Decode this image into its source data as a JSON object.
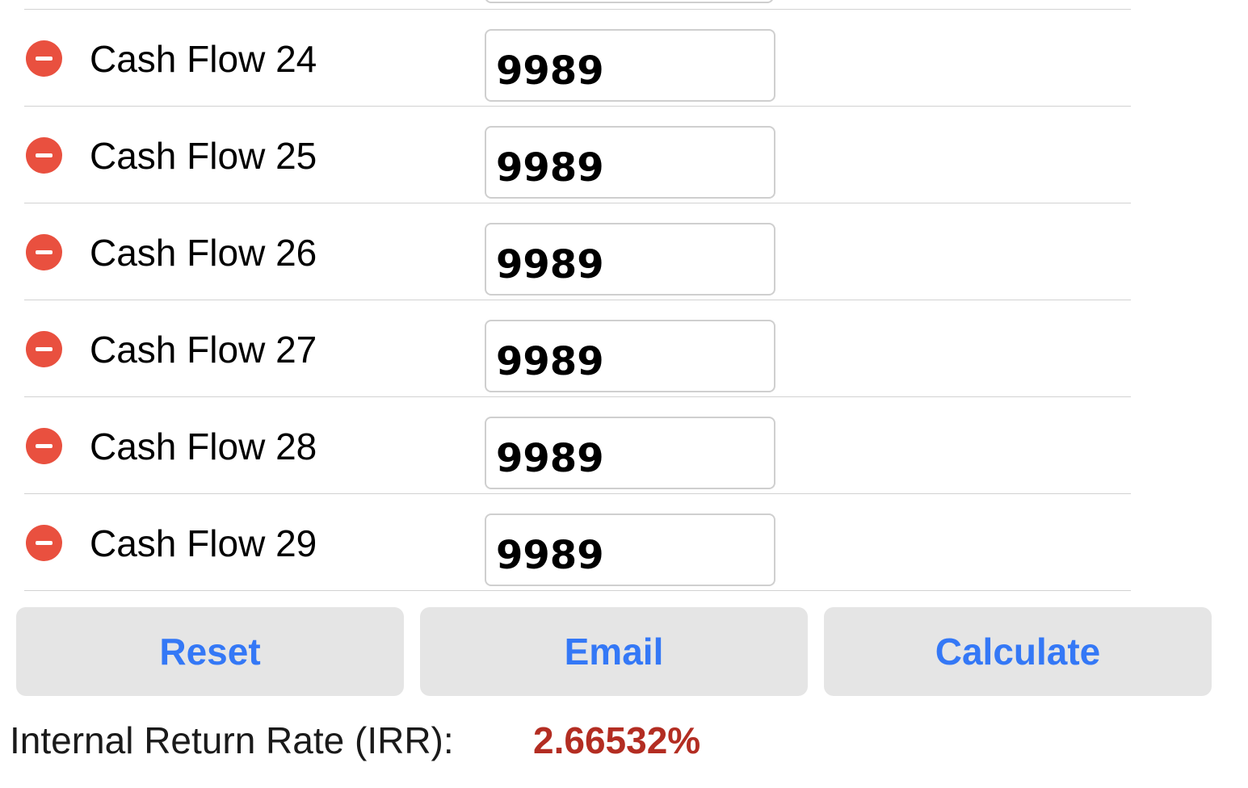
{
  "cash_flows": [
    {
      "label": "Cash Flow 24",
      "value": "9989"
    },
    {
      "label": "Cash Flow 25",
      "value": "9989"
    },
    {
      "label": "Cash Flow 26",
      "value": "9989"
    },
    {
      "label": "Cash Flow 27",
      "value": "9989"
    },
    {
      "label": "Cash Flow 28",
      "value": "9989"
    },
    {
      "label": "Cash Flow 29",
      "value": "9989"
    }
  ],
  "buttons": {
    "reset_label": "Reset",
    "email_label": "Email",
    "calculate_label": "Calculate"
  },
  "result": {
    "label": "Internal Return Rate (IRR):",
    "value": "2.66532%"
  },
  "icons": {
    "remove": "minus-circle-icon"
  },
  "colors": {
    "remove_red": "#e9503f",
    "button_text_blue": "#3478f6",
    "button_bg": "#e5e5e5",
    "result_red": "#b32d22"
  }
}
